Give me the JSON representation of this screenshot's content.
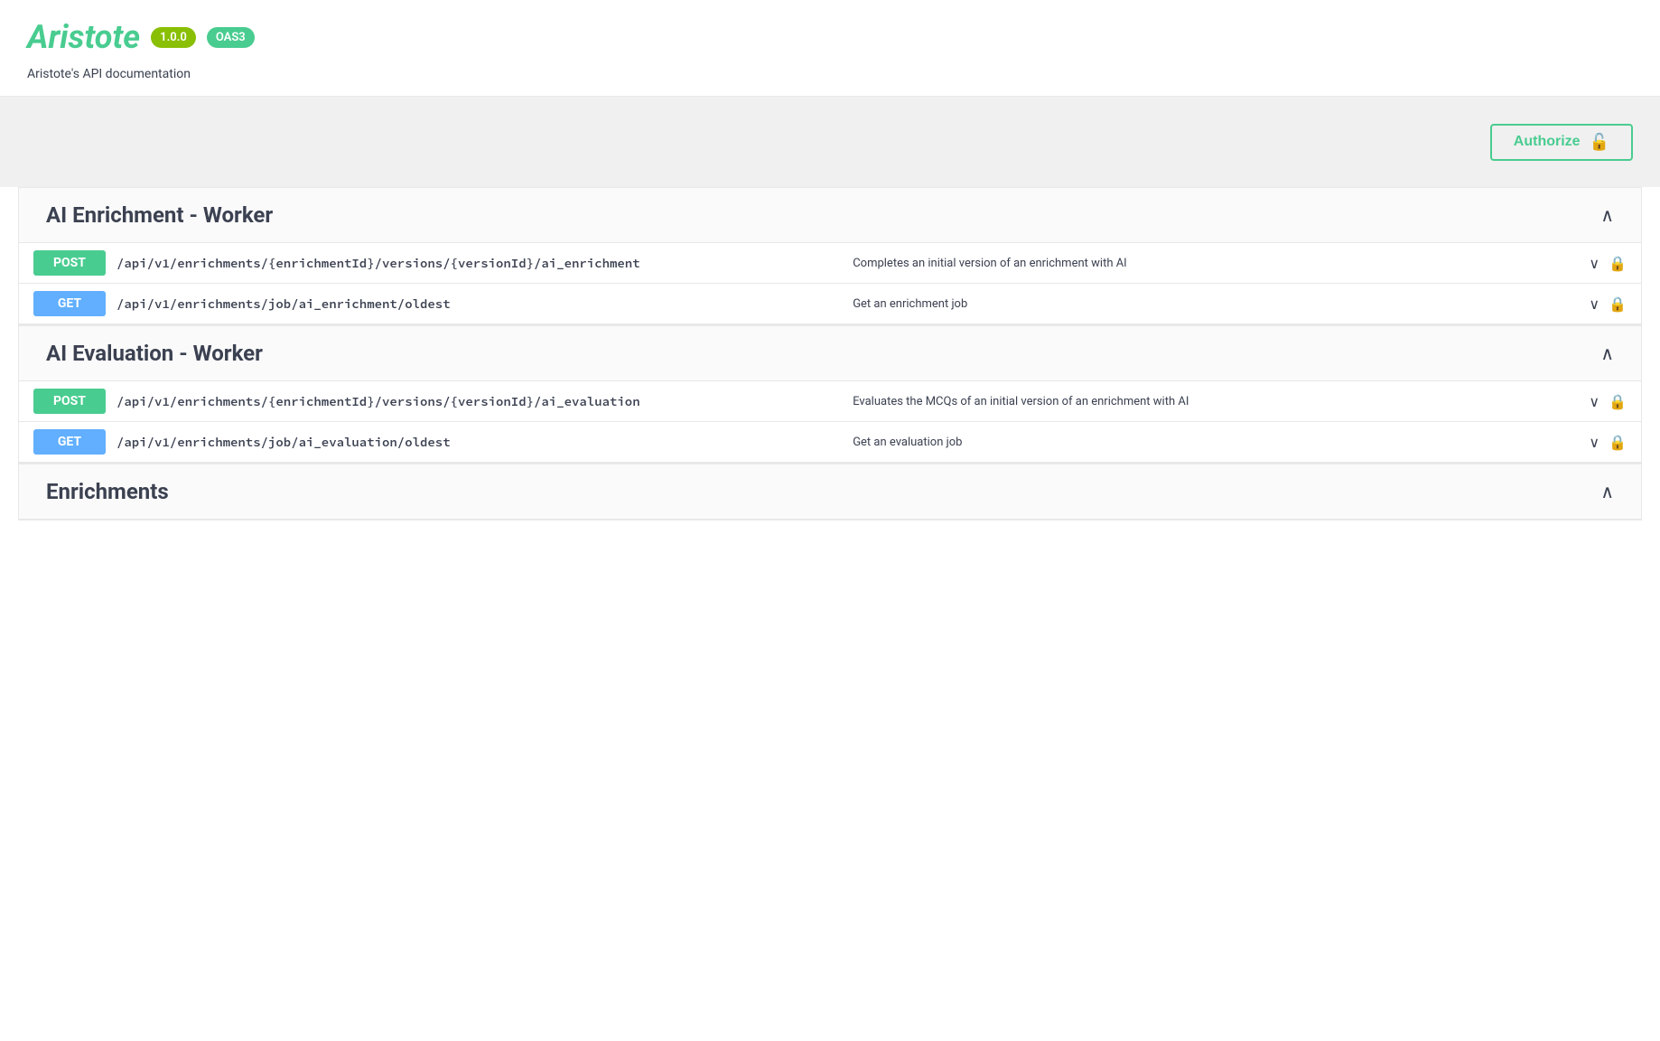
{
  "header": {
    "title": "Aristote",
    "version_badge": "1.0.0",
    "oas_badge": "OAS3",
    "description": "Aristote's API documentation"
  },
  "authorize_button": {
    "label": "Authorize",
    "lock_icon": "🔓"
  },
  "sections": [
    {
      "id": "ai-enrichment-worker",
      "title": "AI Enrichment - Worker",
      "expanded": true,
      "endpoints": [
        {
          "method": "POST",
          "path": "/api/v1/enrichments/{enrichmentId}/versions/{versionId}/ai_enrichment",
          "summary": "Completes an initial version of an enrichment with AI",
          "locked": true
        },
        {
          "method": "GET",
          "path": "/api/v1/enrichments/job/ai_enrichment/oldest",
          "summary": "Get an enrichment job",
          "locked": true
        }
      ]
    },
    {
      "id": "ai-evaluation-worker",
      "title": "AI Evaluation - Worker",
      "expanded": true,
      "endpoints": [
        {
          "method": "POST",
          "path": "/api/v1/enrichments/{enrichmentId}/versions/{versionId}/ai_evaluation",
          "summary": "Evaluates the MCQs of an initial version of an enrichment with AI",
          "locked": true
        },
        {
          "method": "GET",
          "path": "/api/v1/enrichments/job/ai_evaluation/oldest",
          "summary": "Get an evaluation job",
          "locked": true
        }
      ]
    },
    {
      "id": "enrichments",
      "title": "Enrichments",
      "expanded": true,
      "endpoints": []
    }
  ]
}
